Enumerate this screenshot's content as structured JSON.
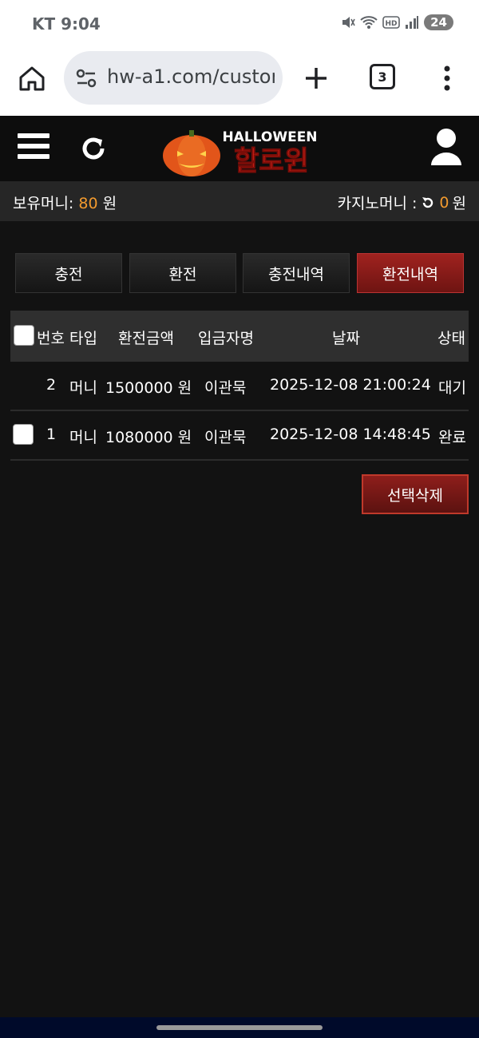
{
  "status": {
    "carrier_time": "KT 9:04",
    "battery": "24"
  },
  "browser": {
    "url": "hw-a1.com/custor",
    "tab_count": "3"
  },
  "logo": {
    "top_text": "HALLOWEEN",
    "main_text": "할로윈"
  },
  "money": {
    "holding_label": "보유머니:",
    "holding_amount": "80",
    "holding_unit": "원",
    "casino_label": "카지노머니 :",
    "casino_amount": "0",
    "casino_unit": "원"
  },
  "tabs": [
    {
      "label": "충전"
    },
    {
      "label": "환전"
    },
    {
      "label": "충전내역"
    },
    {
      "label": "환전내역",
      "active": true
    }
  ],
  "table": {
    "headers": {
      "no": "번호",
      "type": "타입",
      "amount": "환전금액",
      "depositor": "입금자명",
      "date": "날짜",
      "status": "상태"
    },
    "rows": [
      {
        "no": "2",
        "type": "머니",
        "amount": "1500000 원",
        "depositor": "이관묵",
        "date": "2025-12-08 21:00:24",
        "status": "대기",
        "checkbox": false
      },
      {
        "no": "1",
        "type": "머니",
        "amount": "1080000 원",
        "depositor": "이관묵",
        "date": "2025-12-08 14:48:45",
        "status": "완료",
        "checkbox": true
      }
    ]
  },
  "actions": {
    "delete_selected": "선택삭제"
  },
  "colors": {
    "accent": "#f29a2e",
    "active_tab": "#a0221f",
    "background": "#121212"
  }
}
